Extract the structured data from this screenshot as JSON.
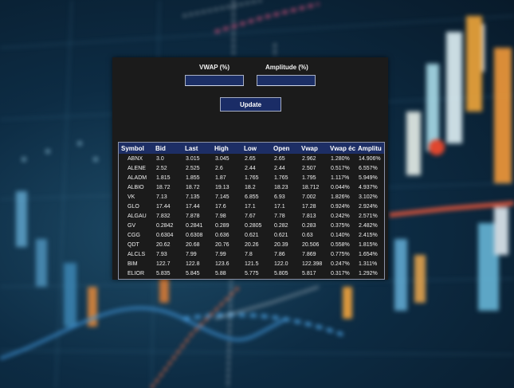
{
  "form": {
    "vwap_label": "VWAP (%)",
    "amplitude_label": "Amplitude (%)",
    "vwap_value": "",
    "amplitude_value": "",
    "update_label": "Update"
  },
  "table": {
    "columns": [
      "Symbol",
      "Bid",
      "Last",
      "High",
      "Low",
      "Open",
      "Vwap",
      "Vwap éc",
      "Amplitu"
    ],
    "rows": [
      [
        "ABNX",
        "3.0",
        "3.015",
        "3.045",
        "2.65",
        "2.65",
        "2.962",
        "1.280%",
        "14.906%"
      ],
      [
        "ALENE",
        "2.52",
        "2.525",
        "2.6",
        "2.44",
        "2.44",
        "2.507",
        "0.517%",
        "6.557%"
      ],
      [
        "ALADM",
        "1.815",
        "1.855",
        "1.87",
        "1.765",
        "1.765",
        "1.795",
        "1.117%",
        "5.949%"
      ],
      [
        "ALBIO",
        "18.72",
        "18.72",
        "19.13",
        "18.2",
        "18.23",
        "18.712",
        "0.044%",
        "4.937%"
      ],
      [
        "VK",
        "7.13",
        "7.135",
        "7.145",
        "6.855",
        "6.93",
        "7.002",
        "1.826%",
        "3.102%"
      ],
      [
        "GLO",
        "17.44",
        "17.44",
        "17.6",
        "17.1",
        "17.1",
        "17.28",
        "0.924%",
        "2.924%"
      ],
      [
        "ALGAU",
        "7.832",
        "7.878",
        "7.98",
        "7.67",
        "7.78",
        "7.813",
        "0.242%",
        "2.571%"
      ],
      [
        "GV",
        "0.2842",
        "0.2841",
        "0.289",
        "0.2805",
        "0.282",
        "0.283",
        "0.375%",
        "2.482%"
      ],
      [
        "CGG",
        "0.6304",
        "0.6308",
        "0.636",
        "0.621",
        "0.621",
        "0.63",
        "0.140%",
        "2.415%"
      ],
      [
        "QDT",
        "20.62",
        "20.68",
        "20.76",
        "20.26",
        "20.39",
        "20.506",
        "0.558%",
        "1.815%"
      ],
      [
        "ALCLS",
        "7.93",
        "7.99",
        "7.99",
        "7.8",
        "7.86",
        "7.869",
        "0.775%",
        "1.654%"
      ],
      [
        "BIM",
        "122.7",
        "122.8",
        "123.6",
        "121.5",
        "122.0",
        "122.398",
        "0.247%",
        "1.311%"
      ],
      [
        "ELIOR",
        "5.835",
        "5.845",
        "5.88",
        "5.775",
        "5.805",
        "5.817",
        "0.317%",
        "1.292%"
      ]
    ]
  }
}
